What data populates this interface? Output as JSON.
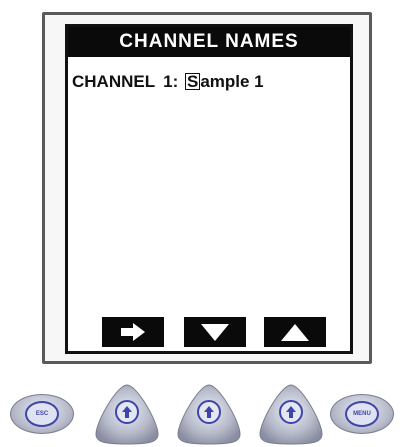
{
  "screen": {
    "title": "CHANNEL NAMES",
    "channel_label": "CHANNEL",
    "channel_number": "1:",
    "name_cursor_char": "S",
    "name_rest": "ample 1"
  },
  "softkeys": [
    {
      "icon": "arrow-right-icon"
    },
    {
      "icon": "arrow-down-icon"
    },
    {
      "icon": "arrow-up-icon"
    }
  ],
  "hardware_buttons": [
    {
      "icon": "esc-oval-icon",
      "label": "ESC"
    },
    {
      "icon": "up-arrow-icon"
    },
    {
      "icon": "up-arrow-icon"
    },
    {
      "icon": "up-arrow-icon"
    },
    {
      "icon": "menu-oval-icon",
      "label": "MENU"
    }
  ],
  "colors": {
    "screen_header_bg": "#0a0a0a",
    "button_accent": "#3d45a8"
  }
}
